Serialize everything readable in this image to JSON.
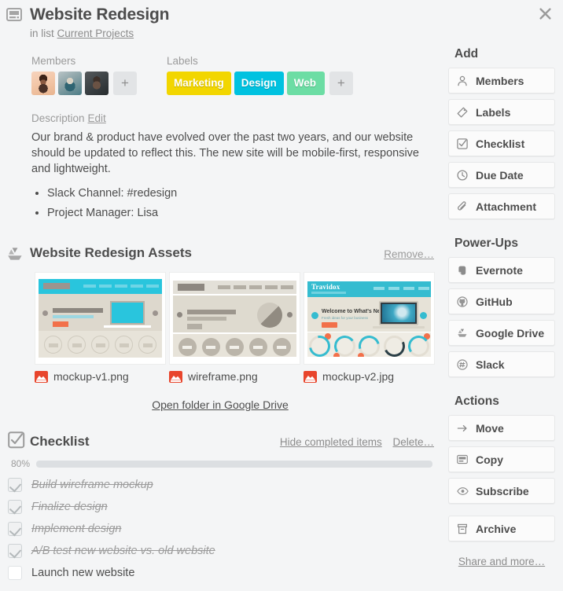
{
  "window": {
    "close_icon": "close-icon"
  },
  "header": {
    "card_icon": "card-icon",
    "title": "Website Redesign",
    "in_list_prefix": "in list",
    "list_name": "Current Projects"
  },
  "members": {
    "label": "Members",
    "avatars": [
      "member-avatar-1",
      "member-avatar-2",
      "member-avatar-3"
    ],
    "add_label": "+"
  },
  "labels": {
    "label": "Labels",
    "chips": [
      {
        "text": "Marketing",
        "color": "#f2d600"
      },
      {
        "text": "Design",
        "color": "#00c2e0"
      },
      {
        "text": "Web",
        "color": "#6cdda4"
      }
    ],
    "add_label": "+"
  },
  "description": {
    "heading": "Description",
    "edit_label": "Edit",
    "body": "Our brand & product have evolved over the past two years, and our website should be updated to reflect this. The new site will be mobile-first, responsive and lightweight.",
    "bullets": [
      "Slack Channel: #redesign",
      "Project Manager: Lisa"
    ]
  },
  "attachments": {
    "icon": "google-drive-icon",
    "title": "Website Redesign Assets",
    "remove_label": "Remove…",
    "files": [
      {
        "name": "mockup-v1.png",
        "thumb": "mockup-v1-thumbnail"
      },
      {
        "name": "wireframe.png",
        "thumb": "wireframe-thumbnail"
      },
      {
        "name": "mockup-v2.jpg",
        "thumb": "mockup-v2-thumbnail"
      }
    ],
    "open_folder_label": "Open folder in Google Drive",
    "thumb3": {
      "brand": "Travidox",
      "headline": "Welcome to What's Next",
      "subhead": "Fresh ideas for your business"
    }
  },
  "checklist": {
    "icon": "checklist-icon",
    "title": "Checklist",
    "hide_completed_label": "Hide completed items",
    "delete_label": "Delete…",
    "percent_text": "80%",
    "percent_value": 80,
    "fill_color": "#5ba4cf",
    "items": [
      {
        "text": "Build wireframe mockup",
        "done": true
      },
      {
        "text": "Finalize design",
        "done": true
      },
      {
        "text": "Implement design",
        "done": true
      },
      {
        "text": "A/B test new website vs. old website",
        "done": true
      },
      {
        "text": "Launch new website",
        "done": false
      }
    ]
  },
  "sidebar": {
    "add_heading": "Add",
    "add_items": [
      {
        "label": "Members",
        "icon": "person-icon"
      },
      {
        "label": "Labels",
        "icon": "tag-icon"
      },
      {
        "label": "Checklist",
        "icon": "checkbox-icon"
      },
      {
        "label": "Due Date",
        "icon": "clock-icon"
      },
      {
        "label": "Attachment",
        "icon": "paperclip-icon"
      }
    ],
    "powerups_heading": "Power-Ups",
    "powerup_items": [
      {
        "label": "Evernote",
        "icon": "evernote-icon"
      },
      {
        "label": "GitHub",
        "icon": "github-icon"
      },
      {
        "label": "Google Drive",
        "icon": "google-drive-icon"
      },
      {
        "label": "Slack",
        "icon": "slack-icon"
      }
    ],
    "actions_heading": "Actions",
    "action_items": [
      {
        "label": "Move",
        "icon": "arrow-right-icon"
      },
      {
        "label": "Copy",
        "icon": "card-icon"
      },
      {
        "label": "Subscribe",
        "icon": "eye-icon"
      }
    ],
    "archive": {
      "label": "Archive",
      "icon": "archive-icon"
    },
    "share_label": "Share and more…"
  }
}
